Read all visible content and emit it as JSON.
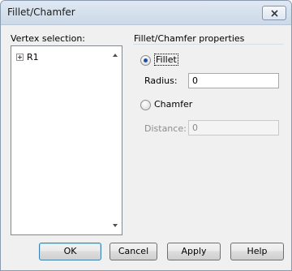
{
  "window": {
    "title": "Fillet/Chamfer"
  },
  "vertex_selection": {
    "label": "Vertex selection:",
    "items": [
      {
        "label": "R1"
      }
    ]
  },
  "properties": {
    "title": "Fillet/Chamfer properties",
    "fillet": {
      "label": "Fillet",
      "selected": true
    },
    "radius": {
      "label": "Radius:",
      "value": "0"
    },
    "chamfer": {
      "label": "Chamfer",
      "selected": false
    },
    "distance": {
      "label": "Distance:",
      "value": "0"
    }
  },
  "buttons": {
    "ok": "OK",
    "cancel": "Cancel",
    "apply": "Apply",
    "help": "Help"
  }
}
